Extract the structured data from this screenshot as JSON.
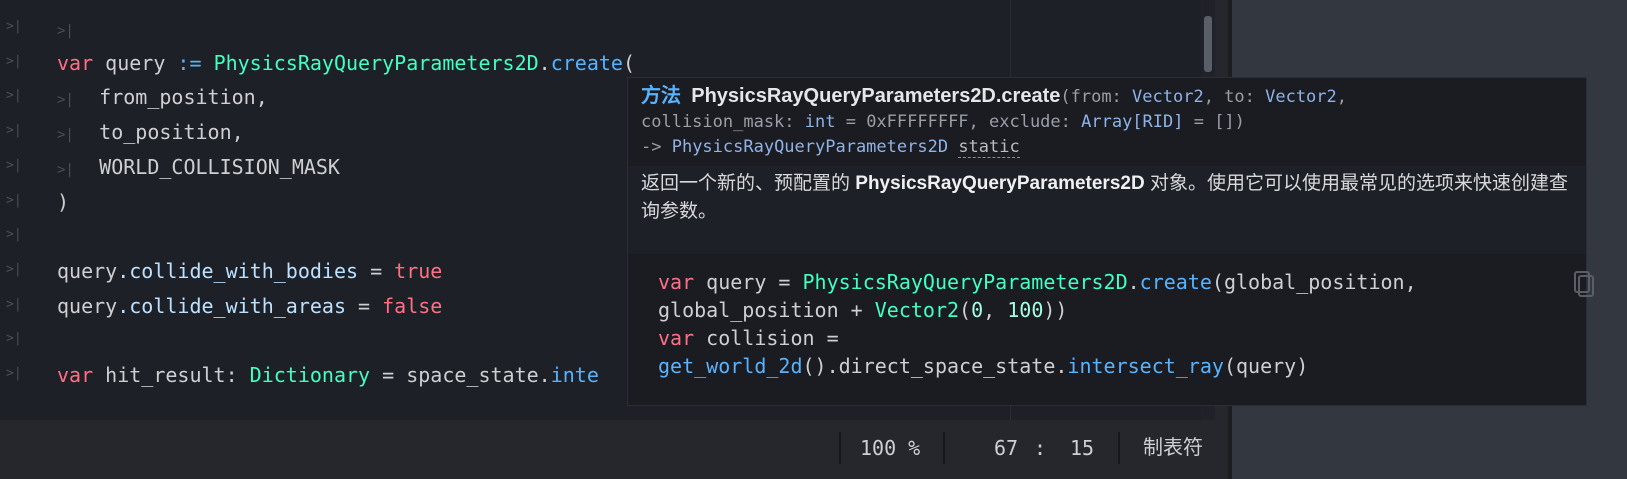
{
  "editor": {
    "code_lines": [
      {
        "tokens": []
      },
      {
        "tokens": [
          {
            "t": "var",
            "c": "kw"
          },
          {
            "t": " query ",
            "c": "ident"
          },
          {
            "t": ":=",
            "c": "fn"
          },
          {
            "t": " ",
            "c": "ident"
          },
          {
            "t": "PhysicsRayQueryParameters2D",
            "c": "cls"
          },
          {
            "t": ".",
            "c": "ident"
          },
          {
            "t": "create",
            "c": "fn"
          },
          {
            "t": "(",
            "c": "ident"
          }
        ]
      },
      {
        "indent": true,
        "tokens": [
          {
            "t": "from_position,",
            "c": "ident"
          }
        ]
      },
      {
        "indent": true,
        "tokens": [
          {
            "t": "to_position,",
            "c": "ident"
          }
        ]
      },
      {
        "indent": true,
        "tokens": [
          {
            "t": "WORLD_COLLISION_MASK",
            "c": "ident"
          }
        ]
      },
      {
        "tokens": [
          {
            "t": ")",
            "c": "ident"
          }
        ]
      },
      {
        "tokens": []
      },
      {
        "tokens": [
          {
            "t": "query",
            "c": "ident"
          },
          {
            "t": ".collide_with_bodies",
            "c": "member"
          },
          {
            "t": " = ",
            "c": "ident"
          },
          {
            "t": "true",
            "c": "bool"
          }
        ]
      },
      {
        "tokens": [
          {
            "t": "query",
            "c": "ident"
          },
          {
            "t": ".collide_with_areas",
            "c": "member"
          },
          {
            "t": " = ",
            "c": "ident"
          },
          {
            "t": "false",
            "c": "bool"
          }
        ]
      },
      {
        "tokens": []
      },
      {
        "tokens": [
          {
            "t": "var",
            "c": "kw"
          },
          {
            "t": " hit_result: ",
            "c": "ident"
          },
          {
            "t": "Dictionary",
            "c": "cls"
          },
          {
            "t": " = space_state.",
            "c": "ident"
          },
          {
            "t": "inte",
            "c": "fn"
          }
        ]
      }
    ],
    "tab_marker": ">|",
    "indent_marker": ">|",
    "first_row_indent_marker": ">|"
  },
  "statusbar": {
    "zoom": "100 %",
    "line": "67",
    "colon": ":",
    "column": "15",
    "indent_mode": "制表符"
  },
  "tooltip": {
    "kind": "方法",
    "class_method": "PhysicsRayQueryParameters2D.create",
    "sig_open": "(from: ",
    "type_vector2_a": "Vector2",
    "sig_to": ", to: ",
    "type_vector2_b": "Vector2",
    "sig_comma": ",",
    "sig_mask": "collision_mask: ",
    "type_int": "int",
    "sig_mask_default": " = 0xFFFFFFFF, exclude: ",
    "type_array": "Array[RID]",
    "sig_exclude_default": " = [])",
    "arrow": "-> ",
    "return_type": "PhysicsRayQueryParameters2D",
    "qualifier": "static",
    "desc_before": "返回一个新的、预配置的 ",
    "desc_bold": "PhysicsRayQueryParameters2D",
    "desc_after": " 对象。使用它可以使用最常见的选项来快速创建查询参数。",
    "example_lines": [
      [
        {
          "t": "var",
          "c": "kw"
        },
        {
          "t": " query = ",
          "c": "ident"
        },
        {
          "t": "PhysicsRayQueryParameters2D",
          "c": "cls"
        },
        {
          "t": ".",
          "c": "ident"
        },
        {
          "t": "create",
          "c": "fn"
        },
        {
          "t": "(global_position,",
          "c": "ident"
        }
      ],
      [
        {
          "t": "global_position + ",
          "c": "ident"
        },
        {
          "t": "Vector2",
          "c": "cls"
        },
        {
          "t": "(",
          "c": "ident"
        },
        {
          "t": "0",
          "c": "num"
        },
        {
          "t": ", ",
          "c": "ident"
        },
        {
          "t": "100",
          "c": "num"
        },
        {
          "t": "))",
          "c": "ident"
        }
      ],
      [
        {
          "t": "var",
          "c": "kw"
        },
        {
          "t": " collision =",
          "c": "ident"
        }
      ],
      [
        {
          "t": "get_world_2d",
          "c": "fn"
        },
        {
          "t": "().direct_space_state.",
          "c": "ident"
        },
        {
          "t": "intersect_ray",
          "c": "fn"
        },
        {
          "t": "(query)",
          "c": "ident"
        }
      ]
    ]
  },
  "colors": {
    "keyword": "#ff7085",
    "class": "#42ffc2",
    "function": "#57b3ff",
    "number": "#a1ffe0",
    "background": "#1d2026"
  }
}
